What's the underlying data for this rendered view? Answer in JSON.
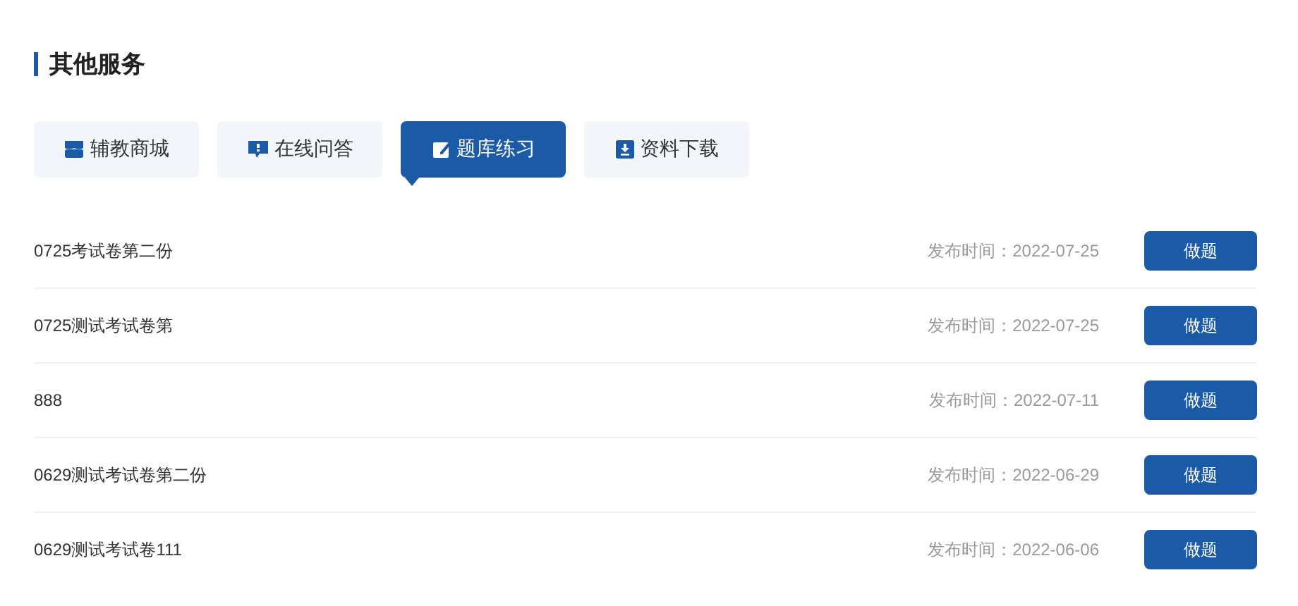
{
  "section_title": "其他服务",
  "tabs": [
    {
      "label": "辅教商城",
      "kind": "store",
      "selected": false
    },
    {
      "label": "在线问答",
      "kind": "question",
      "selected": false
    },
    {
      "label": "题库练习",
      "kind": "edit",
      "selected": true
    },
    {
      "label": "资料下载",
      "kind": "download",
      "selected": false
    }
  ],
  "rows": [
    {
      "title": "0725考试卷第二份",
      "date": "发布时间：2022-07-25",
      "action": "做题"
    },
    {
      "title": "0725测试考试卷第",
      "date": "发布时间：2022-07-25",
      "action": "做题"
    },
    {
      "title": "888",
      "date": "发布时间：2022-07-11",
      "action": "做题"
    },
    {
      "title": "0629测试考试卷第二份",
      "date": "发布时间：2022-06-29",
      "action": "做题"
    },
    {
      "title": "0629测试考试卷111",
      "date": "发布时间：2022-06-06",
      "action": "做题"
    }
  ]
}
